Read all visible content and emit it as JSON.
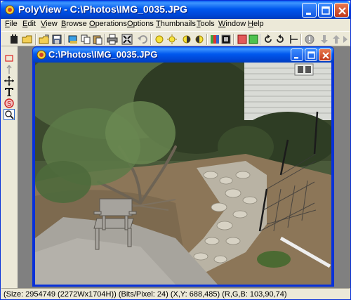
{
  "window": {
    "title": "PolyView - C:\\Photos\\IMG_0035.JPG"
  },
  "menu": [
    "File",
    "Edit",
    "View",
    "Browse",
    "Operations",
    "Options",
    "Thumbnails",
    "Tools",
    "Window",
    "Help"
  ],
  "toolbar_icons": [
    "hand-tool-icon",
    "open-folder-icon",
    "save-icon",
    "browse-icon",
    "paste-icon",
    "copy-icon",
    "delete-icon",
    "print-icon",
    "fit-to-window-icon",
    "undo-icon",
    "brightness-icon",
    "brightness-up-icon",
    "contrast-icon",
    "contrast-up-icon",
    "color-balance-icon",
    "black-square-icon",
    "red-channel-icon",
    "green-channel-icon",
    "rotate-right-icon",
    "rotate-left-icon",
    "flip-icon",
    "info-icon",
    "down-arrow-icon",
    "up-arrow-icon",
    "next-icon"
  ],
  "tools": [
    "select-rect-icon",
    "arrow-icon",
    "move-icon",
    "text-tool-icon",
    "stamp-icon",
    "zoom-icon"
  ],
  "child_window": {
    "title": "C:\\Photos\\IMG_0035.JPG"
  },
  "status": {
    "text": "(Size: 2954749 (2272Wx1704H)) (Bits/Pixel: 24) (X,Y: 688,485) (R,G,B: 103,90,74)"
  },
  "colors": {
    "title_blue": "#0058ee",
    "close_red": "#c1391b",
    "chrome": "#ece9d8"
  }
}
